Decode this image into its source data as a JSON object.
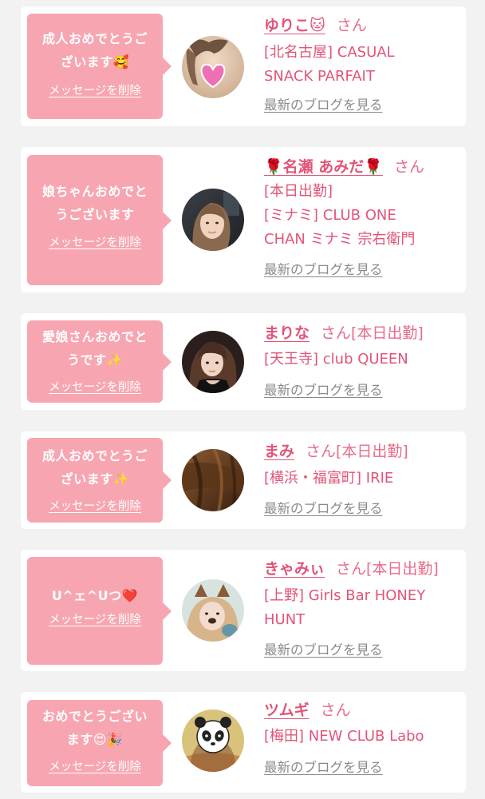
{
  "colors": {
    "background": "#f2f2f3",
    "card": "#ffffff",
    "bubble": "#f7a6b1",
    "accent": "#e25477",
    "link_gray": "#8a8a8a"
  },
  "cards": [
    {
      "message": "成人おめでとうご\nざいます🥰",
      "delete_label": "メッセージを削除",
      "name": "ゆりこ🐱",
      "honorific": "さん",
      "details": "[北名古屋] CASUAL\nSNACK PARFAIT",
      "blog_label": "最新のブログを見る",
      "avatar_icon": "profile-photo-heart-stamp"
    },
    {
      "message": "娘ちゃんおめでと\nうございます",
      "delete_label": "メッセージを削除",
      "name": "🌹名瀬 あみだ🌹",
      "honorific": "さん",
      "details": "[本日出勤]\n[ミナミ] CLUB ONE\nCHAN ミナミ 宗右衛門",
      "blog_label": "最新のブログを見る",
      "avatar_icon": "profile-photo"
    },
    {
      "message": "愛娘さんおめでと\nうです✨",
      "delete_label": "メッセージを削除",
      "name": "まりな",
      "honorific": "さん[本日出勤]",
      "details": "[天王寺] club QUEEN",
      "blog_label": "最新のブログを見る",
      "avatar_icon": "profile-photo"
    },
    {
      "message": "成人おめでとうご\nざいます✨",
      "delete_label": "メッセージを削除",
      "name": "まみ",
      "honorific": "さん[本日出勤]",
      "details": "[横浜・福富町] IRIE",
      "blog_label": "最新のブログを見る",
      "avatar_icon": "profile-photo"
    },
    {
      "message": "U^ェ^Uつ❤️",
      "delete_label": "メッセージを削除",
      "name": "きゃみぃ",
      "honorific": "さん[本日出勤]",
      "details": "[上野] Girls Bar HONEY\nHUNT",
      "blog_label": "最新のブログを見る",
      "avatar_icon": "profile-photo-dog-filter"
    },
    {
      "message": "おめでとうござい\nます😍🎉",
      "delete_label": "メッセージを削除",
      "name": "ツムギ",
      "honorific": "さん",
      "details": "[梅田] NEW CLUB Labo",
      "blog_label": "最新のブログを見る",
      "avatar_icon": "profile-photo-panda-stamp"
    }
  ]
}
